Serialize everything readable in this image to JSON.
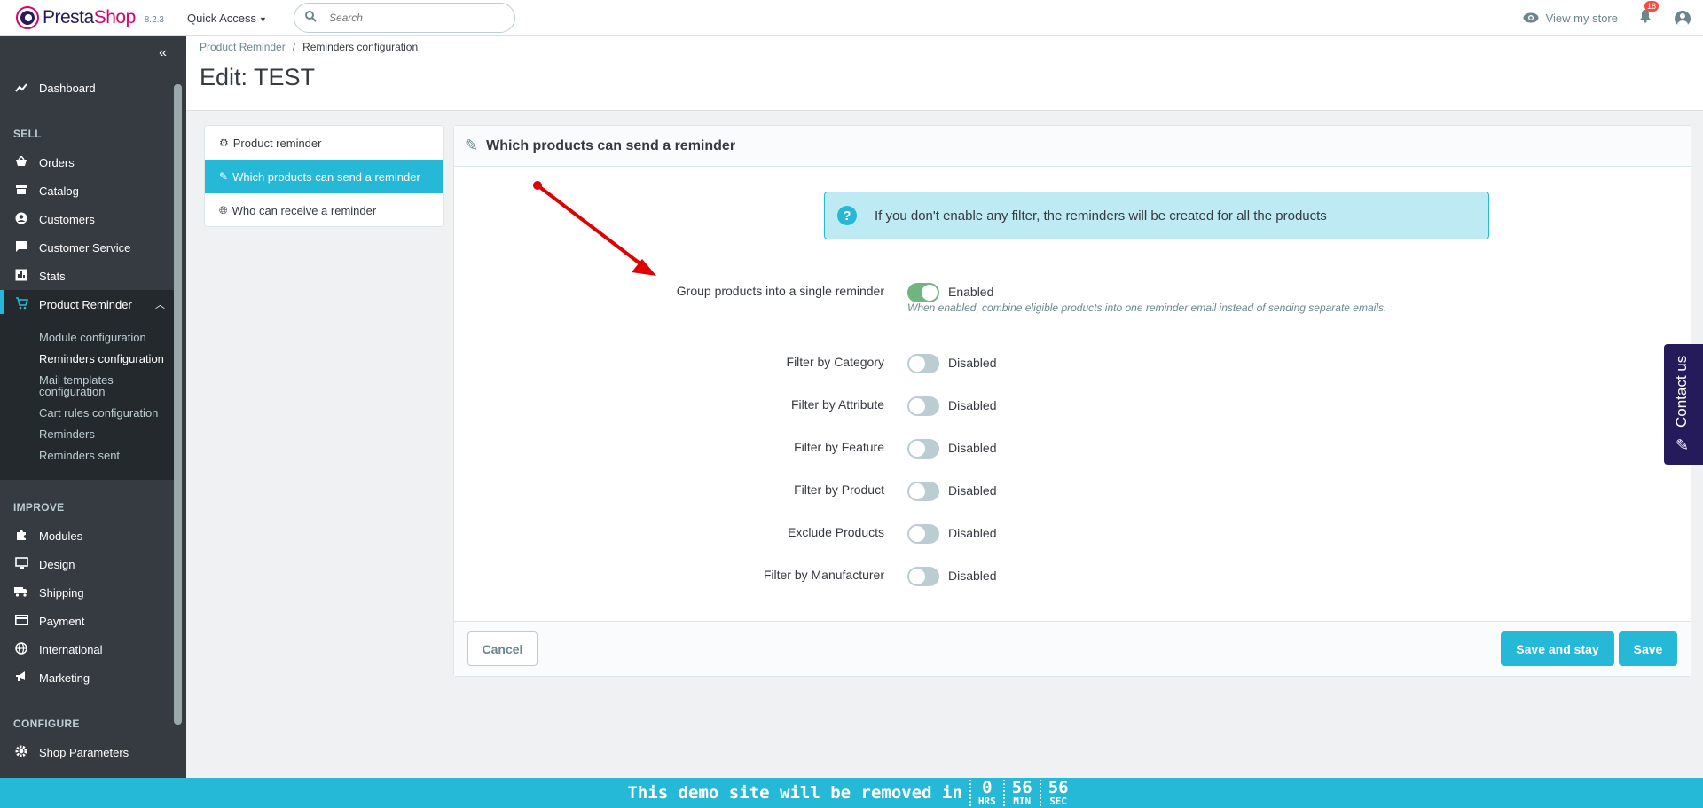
{
  "header": {
    "logo_text_a": "Presta",
    "logo_text_b": "Shop",
    "version": "8.2.3",
    "quick_access": "Quick Access",
    "search_placeholder": "Search",
    "view_store": "View my store",
    "notifications_count": "18"
  },
  "sidebar": {
    "dashboard": "Dashboard",
    "sell_title": "SELL",
    "orders": "Orders",
    "catalog": "Catalog",
    "customers": "Customers",
    "customer_service": "Customer Service",
    "stats": "Stats",
    "product_reminder": "Product Reminder",
    "sub": {
      "module_configuration": "Module configuration",
      "reminders_configuration": "Reminders configuration",
      "mail_templates_1": "Mail templates",
      "mail_templates_2": "configuration",
      "cart_rules": "Cart rules configuration",
      "reminders": "Reminders",
      "reminders_sent": "Reminders sent"
    },
    "improve_title": "IMPROVE",
    "modules": "Modules",
    "design": "Design",
    "shipping": "Shipping",
    "payment": "Payment",
    "international": "International",
    "marketing": "Marketing",
    "configure_title": "CONFIGURE",
    "shop_parameters": "Shop Parameters"
  },
  "breadcrumb": {
    "parent": "Product Reminder",
    "current": "Reminders configuration"
  },
  "page_title": "Edit: TEST",
  "tabs": {
    "product_reminder": "Product reminder",
    "which_products": "Which products can send a reminder",
    "who_can_receive": "Who can receive a reminder"
  },
  "panel": {
    "heading": "Which products can send a reminder",
    "alert": "If you don't enable any filter, the reminders will be created for all the products",
    "help": "When enabled, combine eligible products into one reminder email instead of sending separate emails.",
    "rows": [
      {
        "label": "Group products into a single reminder",
        "state": "Enabled"
      },
      {
        "label": "Filter by Category",
        "state": "Disabled"
      },
      {
        "label": "Filter by Attribute",
        "state": "Disabled"
      },
      {
        "label": "Filter by Feature",
        "state": "Disabled"
      },
      {
        "label": "Filter by Product",
        "state": "Disabled"
      },
      {
        "label": "Exclude Products",
        "state": "Disabled"
      },
      {
        "label": "Filter by Manufacturer",
        "state": "Disabled"
      }
    ],
    "cancel": "Cancel",
    "save_and_stay": "Save and stay",
    "save": "Save"
  },
  "contact_us": "Contact us",
  "demo": {
    "message": "This demo site will be removed in",
    "hrs": "0",
    "hrs_label": "HRS",
    "min": "56",
    "min_label": "MIN",
    "sec": "56",
    "sec_label": "SEC"
  },
  "colors": {
    "accent": "#25b9d7",
    "sidebar": "#363a41",
    "toggle_on": "#70b580",
    "arrow": "#e00000"
  }
}
